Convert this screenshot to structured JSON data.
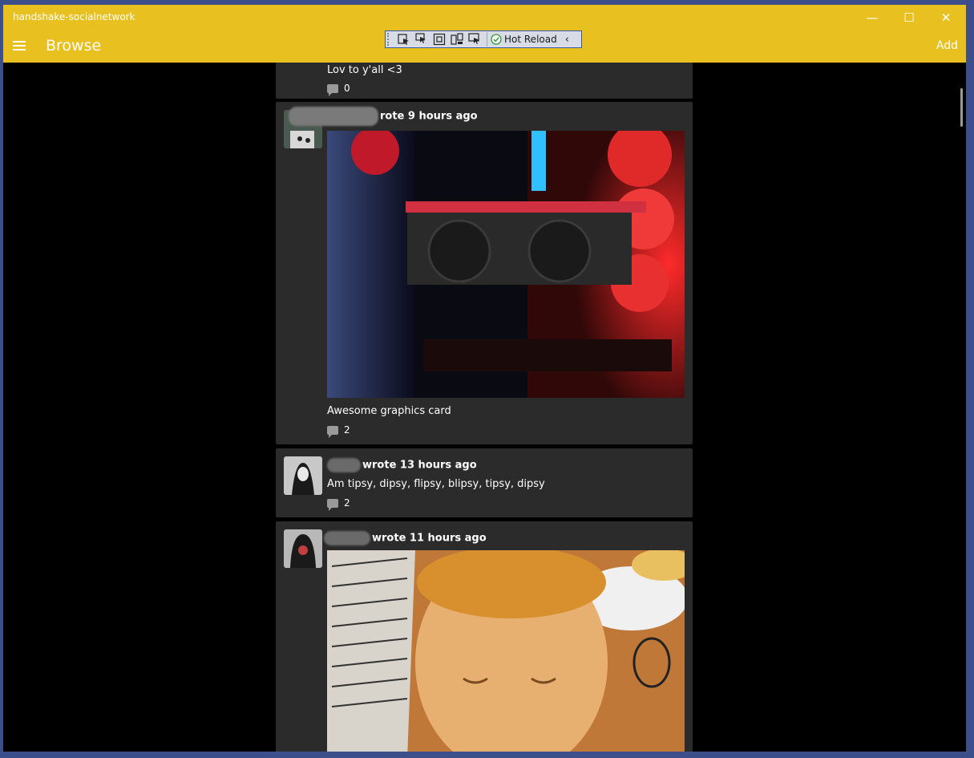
{
  "window": {
    "title": "handshake-socialnetwork",
    "minimize_glyph": "—",
    "maximize_glyph": "☐",
    "close_glyph": "✕"
  },
  "header": {
    "menu_icon": "hamburger-icon",
    "page_title": "Browse",
    "add_label": "Add",
    "background": "#e8c020"
  },
  "debug_toolbar": {
    "icons": [
      "select-element-icon",
      "select-pointer-icon",
      "layout-adorner-icon",
      "track-focus-icon",
      "display-layout-icon"
    ],
    "hot_reload_label": "Hot Reload",
    "hot_reload_status": "ok",
    "collapse_glyph": "‹"
  },
  "feed": {
    "posts": [
      {
        "text": "Lov to y'all <3",
        "comment_count": "0"
      },
      {
        "author_suffix": "rote 9 hours ago",
        "image": "pc-graphics-card-photo",
        "text": "Awesome graphics card",
        "comment_count": "2"
      },
      {
        "author_suffix": "wrote 13 hours ago",
        "text": "Am tipsy, dipsy, flipsy, blipsy, tipsy, dipsy",
        "comment_count": "2"
      },
      {
        "author_suffix": "wrote 11 hours ago",
        "image": "buddha-figure-photo"
      }
    ]
  }
}
